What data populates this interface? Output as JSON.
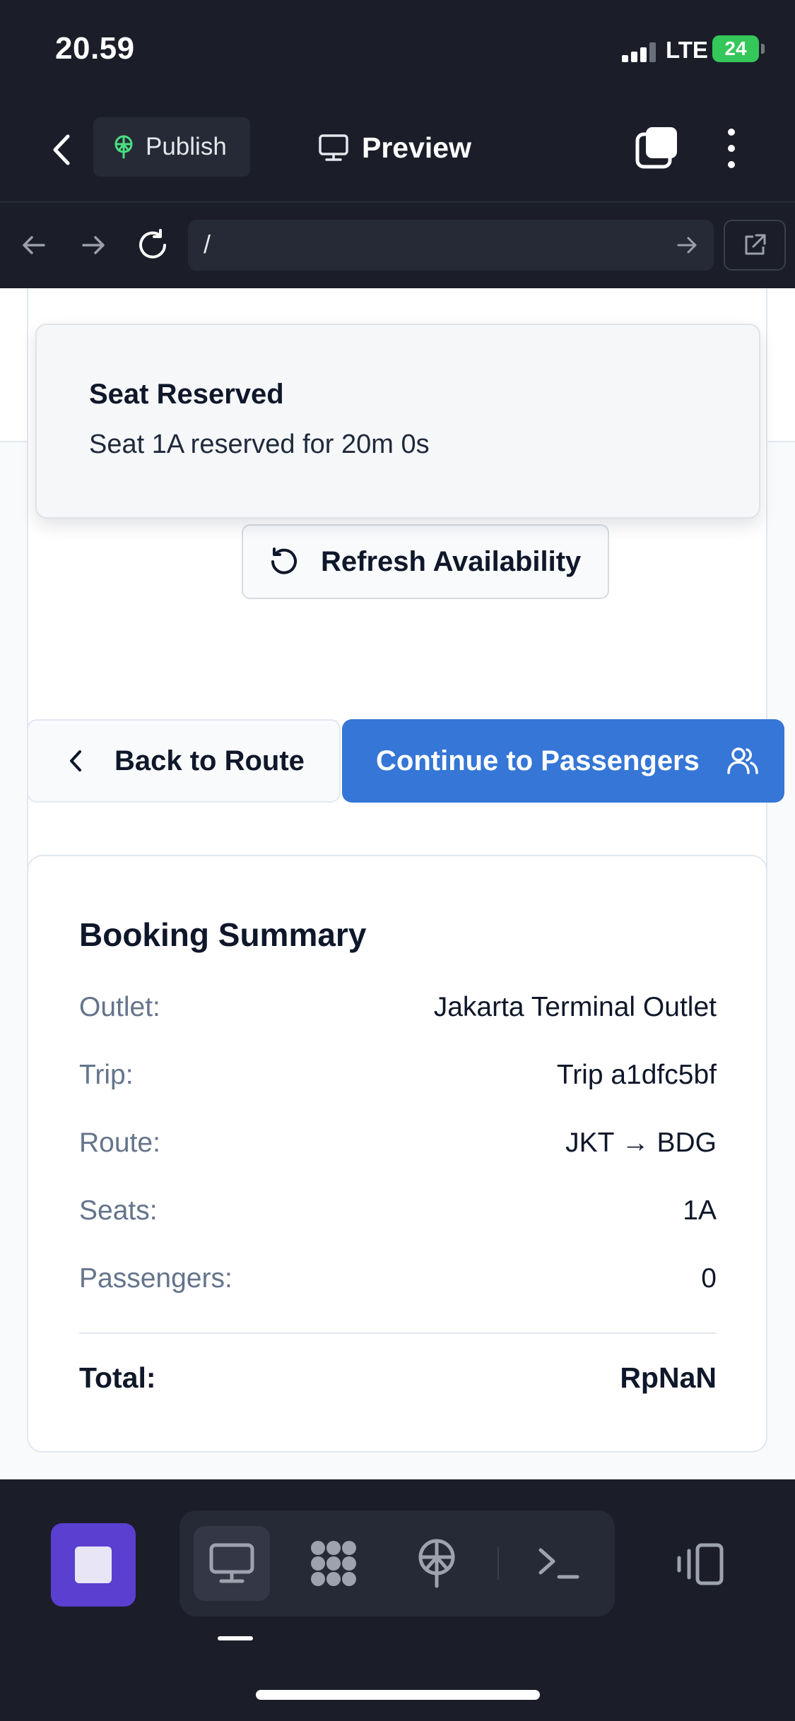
{
  "status_bar": {
    "time": "20.59",
    "network": "LTE",
    "battery": "24"
  },
  "app_header": {
    "publish_label": "Publish",
    "preview_label": "Preview"
  },
  "browser": {
    "url": "/"
  },
  "toast": {
    "title": "Seat Reserved",
    "description": "Seat 1A reserved for 20m 0s"
  },
  "seat_selection": {
    "refresh_label": "Refresh Availability"
  },
  "navigation": {
    "back_label": "Back to Route",
    "continue_label": "Continue to Passengers"
  },
  "booking_summary": {
    "title": "Booking Summary",
    "rows": [
      {
        "label": "Outlet:",
        "value": "Jakarta Terminal Outlet"
      },
      {
        "label": "Trip:",
        "value": "Trip a1dfc5bf"
      },
      {
        "label": "Route:",
        "value": "JKT → BDG"
      },
      {
        "label": "Seats:",
        "value": "1A"
      },
      {
        "label": "Passengers:",
        "value": "0"
      }
    ],
    "total_label": "Total:",
    "total_value": "RpNaN"
  },
  "colors": {
    "primary": "#3576d6",
    "stop_button": "#5b3fd1",
    "publish_icon": "#4ade80"
  },
  "bottom_toolbar": {
    "icons": [
      "stop-icon",
      "desktop-icon",
      "apps-icon",
      "publish-icon",
      "terminal-icon",
      "panel-icon"
    ]
  }
}
